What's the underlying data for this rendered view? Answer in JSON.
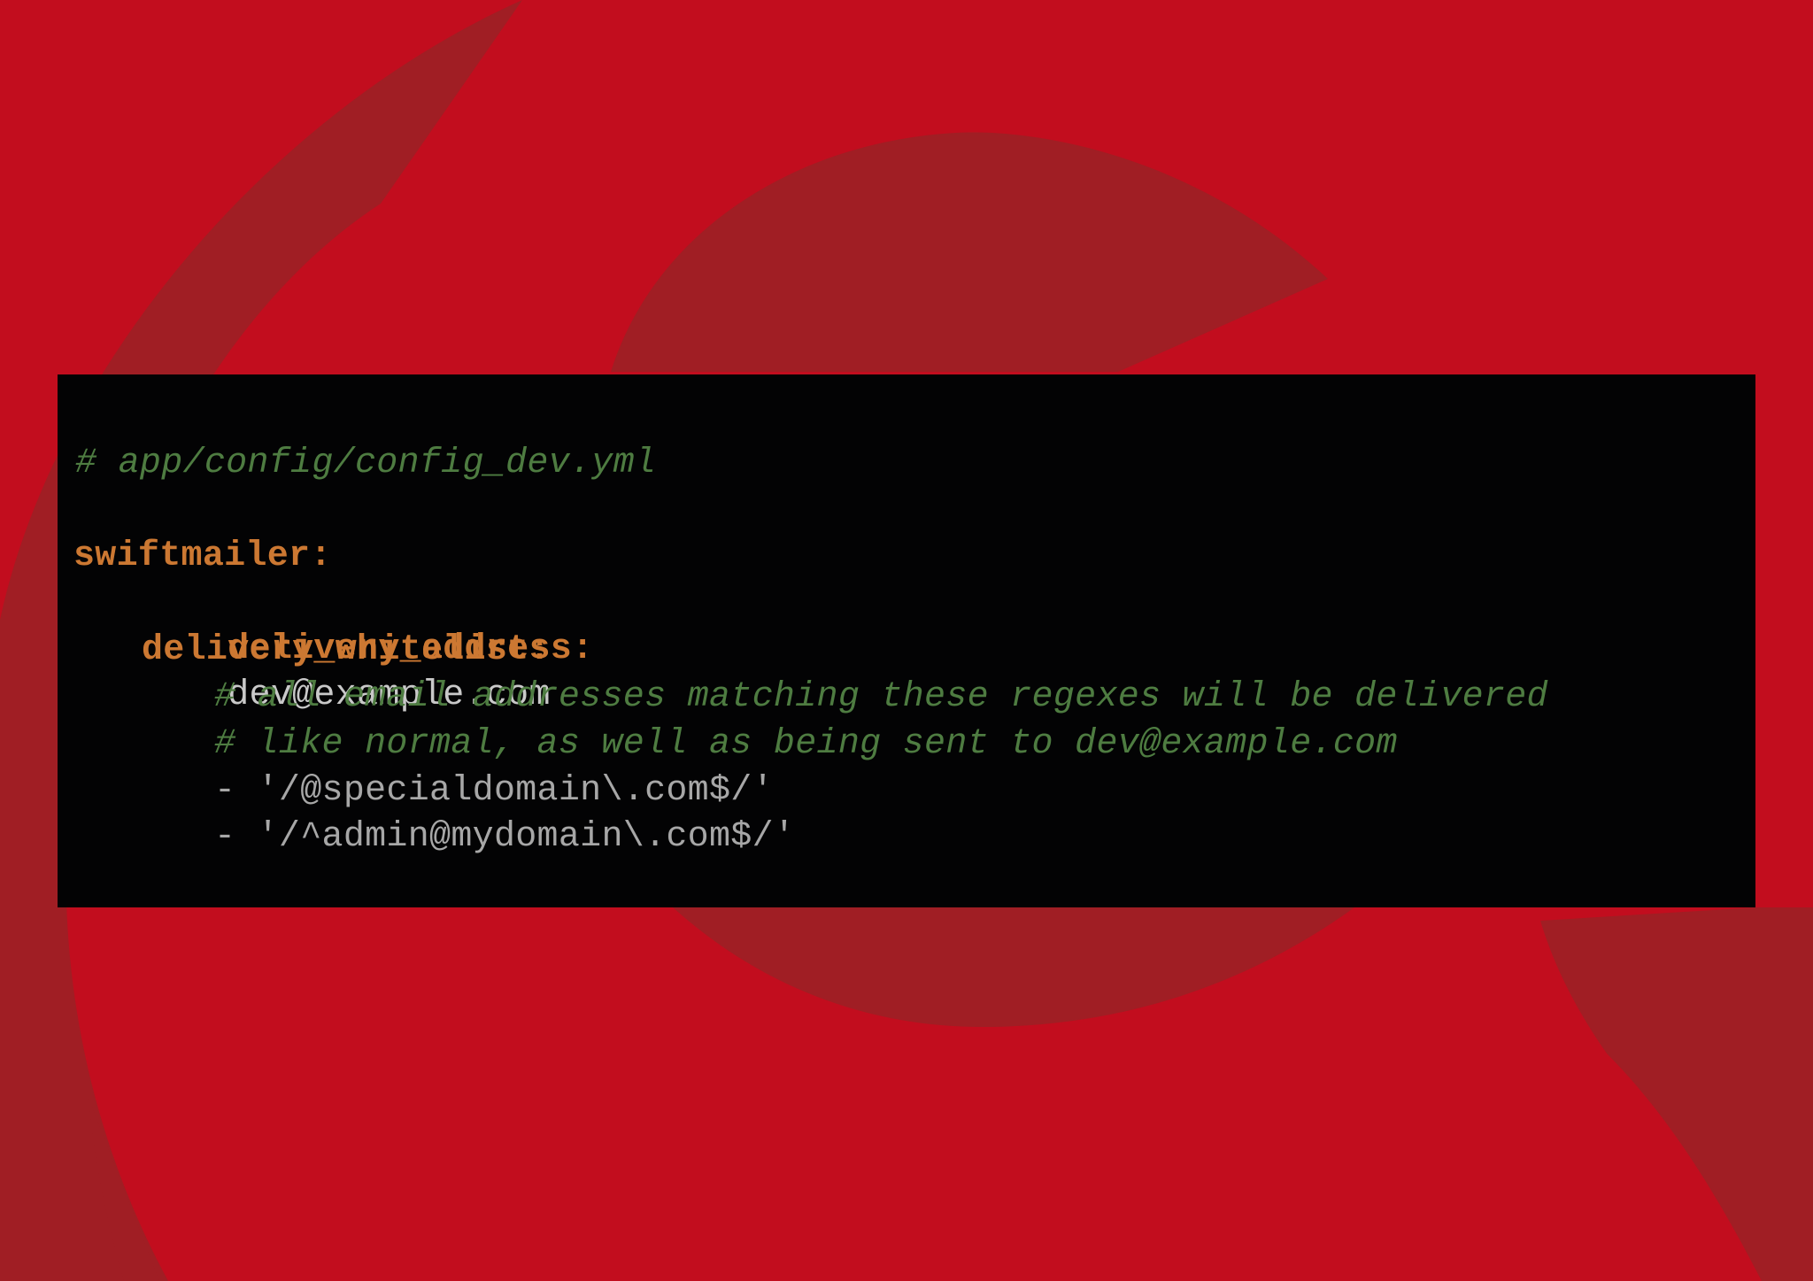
{
  "background": {
    "base_color": "#c20d1e",
    "logo_color": "#a01e24"
  },
  "code": {
    "file_comment": "# app/config/config_dev.yml",
    "root_key": "swiftmailer:",
    "delivery_address_key": "delivery_address:",
    "delivery_address_value": "dev@example.com",
    "delivery_whitelist_key": "delivery_whitelist:",
    "comment_line_1": "# all email addresses matching these regexes will be delivered",
    "comment_line_2": "# like normal, as well as being sent to dev@example.com",
    "whitelist_item_1": "- '/@specialdomain\\.com$/'",
    "whitelist_item_2": "- '/^admin@mydomain\\.com$/'"
  },
  "colors": {
    "comment": "#4e7c41",
    "key": "#cc7832",
    "value": "#c9c9c9",
    "panel_bg": "#030304"
  }
}
